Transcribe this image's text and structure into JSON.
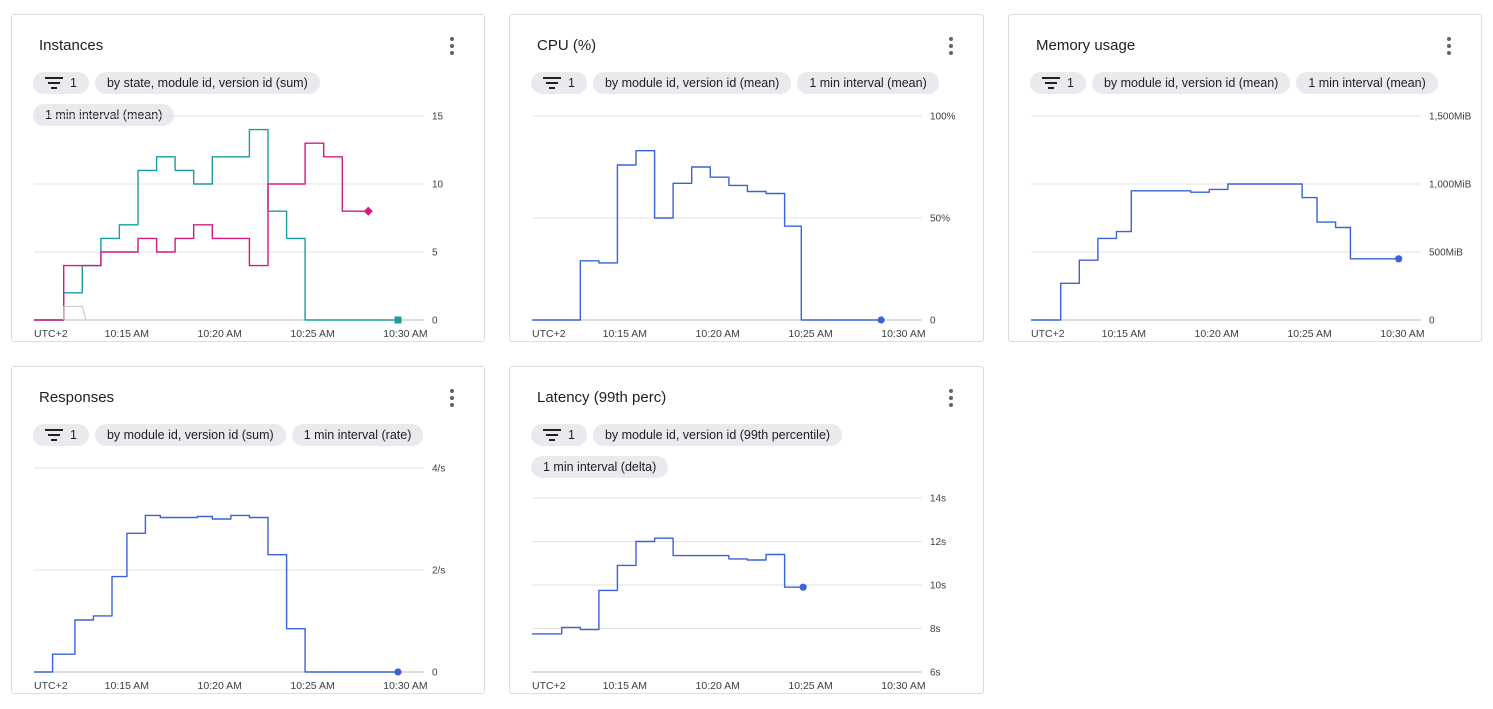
{
  "colors": {
    "blue": "#3b62d9",
    "teal": "#1a9e9e",
    "magenta": "#d41a7f",
    "grid": "#e3e3e3",
    "axis_text": "#3c4043"
  },
  "cards": [
    {
      "title": "Instances",
      "chips": [
        {
          "type": "filter",
          "label": "1",
          "icon": "filter-icon"
        },
        {
          "type": "label",
          "label": "by state, module id, version id (sum)"
        },
        {
          "type": "label",
          "label": "1 min interval (mean)"
        }
      ],
      "chart_data": {
        "type": "line",
        "x_start": "10:10",
        "x_end": "10:31",
        "tz_label": "UTC+2",
        "x_ticks": [
          "10:15 AM",
          "10:20 AM",
          "10:25 AM",
          "10:30 AM"
        ],
        "y_range": [
          0,
          15
        ],
        "y_ticks": [
          {
            "v": 0,
            "label": "0"
          },
          {
            "v": 5,
            "label": "5"
          },
          {
            "v": 10,
            "label": "10"
          },
          {
            "v": 15,
            "label": "15"
          }
        ],
        "series": [
          {
            "color": "#1a9e9e",
            "end_marker": "square",
            "points": [
              [
                "10:10",
                0
              ],
              [
                "10:11.6",
                0
              ],
              [
                "10:11.6",
                2
              ],
              [
                "10:12.6",
                2
              ],
              [
                "10:12.6",
                4
              ],
              [
                "10:13.6",
                4
              ],
              [
                "10:13.6",
                6
              ],
              [
                "10:14.6",
                6
              ],
              [
                "10:14.6",
                7
              ],
              [
                "10:15.6",
                7
              ],
              [
                "10:15.6",
                11
              ],
              [
                "10:16.6",
                11
              ],
              [
                "10:16.6",
                12
              ],
              [
                "10:17.6",
                12
              ],
              [
                "10:17.6",
                11
              ],
              [
                "10:18.6",
                11
              ],
              [
                "10:18.6",
                10
              ],
              [
                "10:19.6",
                10
              ],
              [
                "10:19.6",
                12
              ],
              [
                "10:21.6",
                12
              ],
              [
                "10:21.6",
                14
              ],
              [
                "10:22.6",
                14
              ],
              [
                "10:22.6",
                8
              ],
              [
                "10:23.6",
                8
              ],
              [
                "10:23.6",
                6
              ],
              [
                "10:24.6",
                6
              ],
              [
                "10:24.6",
                0
              ],
              [
                "10:29.6",
                0
              ]
            ]
          },
          {
            "color": "#d41a7f",
            "end_marker": "diamond",
            "points": [
              [
                "10:10",
                0
              ],
              [
                "10:11.6",
                0
              ],
              [
                "10:11.6",
                4
              ],
              [
                "10:13.6",
                4
              ],
              [
                "10:13.6",
                5
              ],
              [
                "10:15.6",
                5
              ],
              [
                "10:15.6",
                6
              ],
              [
                "10:16.6",
                6
              ],
              [
                "10:16.6",
                5
              ],
              [
                "10:17.6",
                5
              ],
              [
                "10:17.6",
                6
              ],
              [
                "10:18.6",
                6
              ],
              [
                "10:18.6",
                7
              ],
              [
                "10:19.6",
                7
              ],
              [
                "10:19.6",
                6
              ],
              [
                "10:21.6",
                6
              ],
              [
                "10:21.6",
                4
              ],
              [
                "10:22.6",
                4
              ],
              [
                "10:22.6",
                10
              ],
              [
                "10:24.6",
                10
              ],
              [
                "10:24.6",
                13
              ],
              [
                "10:25.6",
                13
              ],
              [
                "10:25.6",
                12
              ],
              [
                "10:26.6",
                12
              ],
              [
                "10:26.6",
                8
              ],
              [
                "10:28.0",
                8
              ]
            ]
          },
          {
            "color": "#c8c8c8",
            "end_marker": "none",
            "points": [
              [
                "10:11.6",
                0
              ],
              [
                "10:11.6",
                1
              ],
              [
                "10:12.6",
                1
              ],
              [
                "10:12.8",
                0
              ]
            ]
          }
        ]
      }
    },
    {
      "title": "CPU (%)",
      "chips": [
        {
          "type": "filter",
          "label": "1",
          "icon": "filter-icon"
        },
        {
          "type": "label",
          "label": "by module id, version id (mean)"
        },
        {
          "type": "label",
          "label": "1 min interval (mean)"
        }
      ],
      "chart_data": {
        "type": "line",
        "x_start": "10:10",
        "x_end": "10:31",
        "tz_label": "UTC+2",
        "x_ticks": [
          "10:15 AM",
          "10:20 AM",
          "10:25 AM",
          "10:30 AM"
        ],
        "y_range": [
          0,
          100
        ],
        "y_ticks": [
          {
            "v": 0,
            "label": "0"
          },
          {
            "v": 50,
            "label": "50%"
          },
          {
            "v": 100,
            "label": "100%"
          }
        ],
        "series": [
          {
            "color": "#3b62d9",
            "end_marker": "circle",
            "points": [
              [
                "10:10",
                0
              ],
              [
                "10:12.6",
                0
              ],
              [
                "10:12.6",
                29
              ],
              [
                "10:13.6",
                29
              ],
              [
                "10:13.6",
                28
              ],
              [
                "10:14.6",
                28
              ],
              [
                "10:14.6",
                76
              ],
              [
                "10:15.6",
                76
              ],
              [
                "10:15.6",
                83
              ],
              [
                "10:16.6",
                83
              ],
              [
                "10:16.6",
                50
              ],
              [
                "10:17.6",
                50
              ],
              [
                "10:17.6",
                67
              ],
              [
                "10:18.6",
                67
              ],
              [
                "10:18.6",
                75
              ],
              [
                "10:19.6",
                75
              ],
              [
                "10:19.6",
                70
              ],
              [
                "10:20.6",
                70
              ],
              [
                "10:20.6",
                66
              ],
              [
                "10:21.6",
                66
              ],
              [
                "10:21.6",
                63
              ],
              [
                "10:22.6",
                63
              ],
              [
                "10:22.6",
                62
              ],
              [
                "10:23.6",
                62
              ],
              [
                "10:23.6",
                46
              ],
              [
                "10:24.5",
                46
              ],
              [
                "10:24.5",
                0
              ],
              [
                "10:28.8",
                0
              ]
            ]
          }
        ]
      }
    },
    {
      "title": "Memory usage",
      "chips": [
        {
          "type": "filter",
          "label": "1",
          "icon": "filter-icon"
        },
        {
          "type": "label",
          "label": "by module id, version id (mean)"
        },
        {
          "type": "label",
          "label": "1 min interval (mean)"
        }
      ],
      "chart_data": {
        "type": "line",
        "x_start": "10:10",
        "x_end": "10:31",
        "tz_label": "UTC+2",
        "x_ticks": [
          "10:15 AM",
          "10:20 AM",
          "10:25 AM",
          "10:30 AM"
        ],
        "y_range": [
          0,
          1500
        ],
        "y_ticks": [
          {
            "v": 0,
            "label": "0"
          },
          {
            "v": 500,
            "label": "500MiB"
          },
          {
            "v": 1000,
            "label": "1,000MiB"
          },
          {
            "v": 1500,
            "label": "1,500MiB"
          }
        ],
        "series": [
          {
            "color": "#3b62d9",
            "end_marker": "circle",
            "points": [
              [
                "10:10",
                0
              ],
              [
                "10:11.6",
                0
              ],
              [
                "10:11.6",
                270
              ],
              [
                "10:12.6",
                270
              ],
              [
                "10:12.6",
                440
              ],
              [
                "10:13.6",
                440
              ],
              [
                "10:13.6",
                600
              ],
              [
                "10:14.6",
                600
              ],
              [
                "10:14.6",
                650
              ],
              [
                "10:15.4",
                650
              ],
              [
                "10:15.4",
                950
              ],
              [
                "10:18.6",
                950
              ],
              [
                "10:18.6",
                940
              ],
              [
                "10:19.6",
                940
              ],
              [
                "10:19.6",
                960
              ],
              [
                "10:20.6",
                960
              ],
              [
                "10:20.6",
                1000
              ],
              [
                "10:24.6",
                1000
              ],
              [
                "10:24.6",
                900
              ],
              [
                "10:25.4",
                900
              ],
              [
                "10:25.4",
                720
              ],
              [
                "10:26.4",
                720
              ],
              [
                "10:26.4",
                680
              ],
              [
                "10:27.2",
                680
              ],
              [
                "10:27.2",
                450
              ],
              [
                "10:29.8",
                450
              ]
            ]
          }
        ]
      }
    },
    {
      "title": "Responses",
      "chips": [
        {
          "type": "filter",
          "label": "1",
          "icon": "filter-icon"
        },
        {
          "type": "label",
          "label": "by module id, version id (sum)"
        },
        {
          "type": "label",
          "label": "1 min interval (rate)"
        }
      ],
      "chart_data": {
        "type": "line",
        "x_start": "10:10",
        "x_end": "10:31",
        "tz_label": "UTC+2",
        "x_ticks": [
          "10:15 AM",
          "10:20 AM",
          "10:25 AM",
          "10:30 AM"
        ],
        "y_range": [
          0,
          4
        ],
        "y_ticks": [
          {
            "v": 0,
            "label": "0"
          },
          {
            "v": 2,
            "label": "2/s"
          },
          {
            "v": 4,
            "label": "4/s"
          }
        ],
        "series": [
          {
            "color": "#3b62d9",
            "end_marker": "circle",
            "points": [
              [
                "10:10",
                0
              ],
              [
                "10:11.0",
                0
              ],
              [
                "10:11.0",
                0.35
              ],
              [
                "10:12.2",
                0.35
              ],
              [
                "10:12.2",
                1.02
              ],
              [
                "10:13.2",
                1.02
              ],
              [
                "10:13.2",
                1.1
              ],
              [
                "10:14.2",
                1.1
              ],
              [
                "10:14.2",
                1.87
              ],
              [
                "10:15.0",
                1.87
              ],
              [
                "10:15.0",
                2.72
              ],
              [
                "10:16.0",
                2.72
              ],
              [
                "10:16.0",
                3.07
              ],
              [
                "10:16.8",
                3.07
              ],
              [
                "10:16.8",
                3.03
              ],
              [
                "10:18.8",
                3.03
              ],
              [
                "10:18.8",
                3.05
              ],
              [
                "10:19.6",
                3.05
              ],
              [
                "10:19.6",
                3.0
              ],
              [
                "10:20.6",
                3.0
              ],
              [
                "10:20.6",
                3.07
              ],
              [
                "10:21.6",
                3.07
              ],
              [
                "10:21.6",
                3.03
              ],
              [
                "10:22.6",
                3.03
              ],
              [
                "10:22.6",
                2.3
              ],
              [
                "10:23.6",
                2.3
              ],
              [
                "10:23.6",
                0.85
              ],
              [
                "10:24.6",
                0.85
              ],
              [
                "10:24.6",
                0
              ],
              [
                "10:29.6",
                0
              ]
            ]
          }
        ]
      }
    },
    {
      "title": "Latency (99th perc)",
      "chips": [
        {
          "type": "filter",
          "label": "1",
          "icon": "filter-icon"
        },
        {
          "type": "label",
          "label": "by module id, version id (99th percentile)"
        },
        {
          "type": "label",
          "label": "1 min interval (delta)"
        }
      ],
      "chart_data": {
        "type": "line",
        "x_start": "10:10",
        "x_end": "10:31",
        "tz_label": "UTC+2",
        "x_ticks": [
          "10:15 AM",
          "10:20 AM",
          "10:25 AM",
          "10:30 AM"
        ],
        "y_range": [
          6,
          14
        ],
        "y_ticks": [
          {
            "v": 6,
            "label": "6s"
          },
          {
            "v": 8,
            "label": "8s"
          },
          {
            "v": 10,
            "label": "10s"
          },
          {
            "v": 12,
            "label": "12s"
          },
          {
            "v": 14,
            "label": "14s"
          }
        ],
        "series": [
          {
            "color": "#3b62d9",
            "end_marker": "circle",
            "points": [
              [
                "10:10",
                7.75
              ],
              [
                "10:11.6",
                7.75
              ],
              [
                "10:11.6",
                8.05
              ],
              [
                "10:12.6",
                8.05
              ],
              [
                "10:12.6",
                7.95
              ],
              [
                "10:13.6",
                7.95
              ],
              [
                "10:13.6",
                9.75
              ],
              [
                "10:14.6",
                9.75
              ],
              [
                "10:14.6",
                10.9
              ],
              [
                "10:15.6",
                10.9
              ],
              [
                "10:15.6",
                12.0
              ],
              [
                "10:16.6",
                12.0
              ],
              [
                "10:16.6",
                12.15
              ],
              [
                "10:17.6",
                12.15
              ],
              [
                "10:17.6",
                11.35
              ],
              [
                "10:20.6",
                11.35
              ],
              [
                "10:20.6",
                11.2
              ],
              [
                "10:21.6",
                11.2
              ],
              [
                "10:21.6",
                11.15
              ],
              [
                "10:22.6",
                11.15
              ],
              [
                "10:22.6",
                11.4
              ],
              [
                "10:23.6",
                11.4
              ],
              [
                "10:23.6",
                9.9
              ],
              [
                "10:24.6",
                9.9
              ]
            ]
          }
        ]
      }
    }
  ]
}
